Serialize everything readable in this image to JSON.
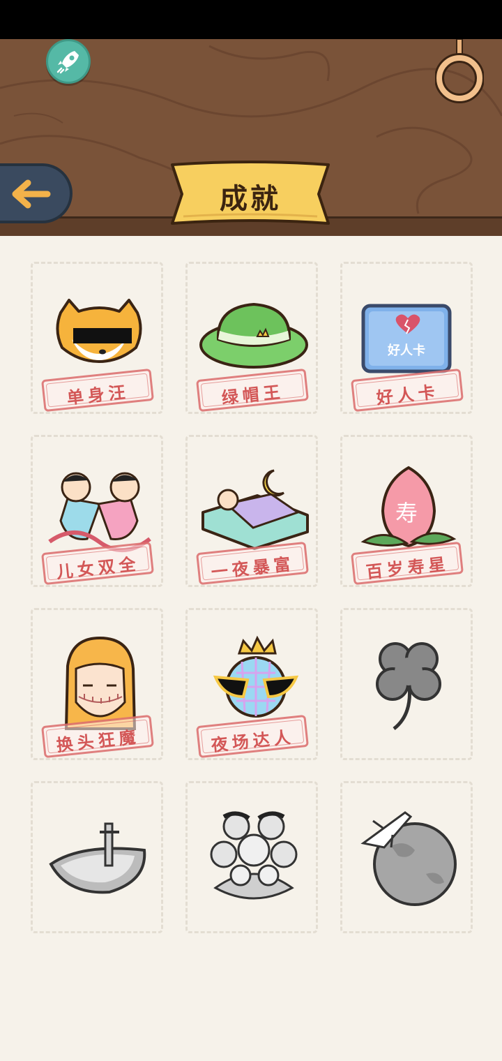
{
  "header": {
    "title": "成就",
    "back_icon": "back-arrow-icon",
    "rocket_icon": "rocket-icon",
    "ring_icon": "hanging-ring-icon"
  },
  "colors": {
    "wood": "#7a5339",
    "banner": "#f7cf5f",
    "stamp_red": "#d65858",
    "page_bg": "#f6f2ea"
  },
  "achievements": [
    {
      "name": "单身汪",
      "icon": "shiba-sunglasses-icon",
      "unlocked": true
    },
    {
      "name": "绿帽王",
      "icon": "green-hat-icon",
      "unlocked": true
    },
    {
      "name": "好人卡",
      "icon": "good-person-card-icon",
      "card_text": "好人卡",
      "unlocked": true
    },
    {
      "name": "儿女双全",
      "icon": "twin-babies-icon",
      "unlocked": true
    },
    {
      "name": "一夜暴富",
      "icon": "money-bed-icon",
      "unlocked": true
    },
    {
      "name": "百岁寿星",
      "icon": "longevity-peach-icon",
      "peach_text": "寿",
      "unlocked": true
    },
    {
      "name": "换头狂魔",
      "icon": "stitched-head-icon",
      "unlocked": true
    },
    {
      "name": "夜场达人",
      "icon": "disco-ball-icon",
      "unlocked": true
    },
    {
      "name": "",
      "icon": "four-leaf-clover-icon",
      "unlocked": false
    },
    {
      "name": "",
      "icon": "boat-icon",
      "unlocked": false
    },
    {
      "name": "",
      "icon": "big-family-icon",
      "unlocked": false
    },
    {
      "name": "",
      "icon": "planet-plane-icon",
      "unlocked": false
    }
  ]
}
